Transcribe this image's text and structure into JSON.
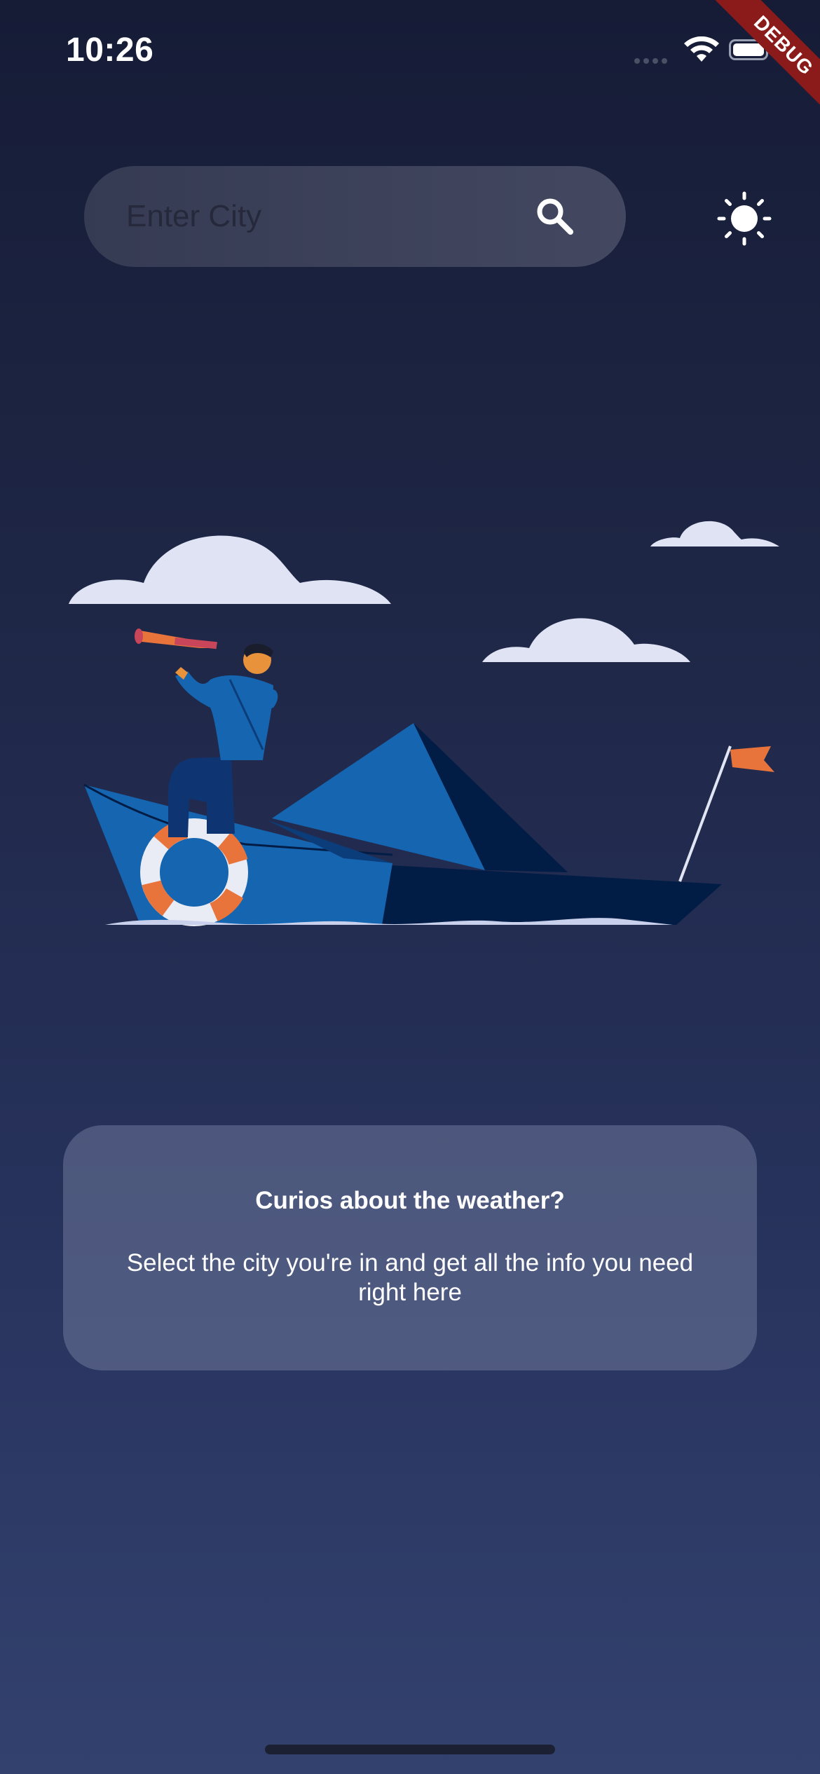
{
  "status_bar": {
    "time": "10:26",
    "signal_icon": "cellular-signal-icon",
    "wifi_icon": "wifi-icon",
    "battery_icon": "battery-icon"
  },
  "debug_banner": {
    "label": "DEBUG",
    "color": "#8b1a1a"
  },
  "search": {
    "placeholder": "Enter City",
    "value": "",
    "icon": "search-icon"
  },
  "theme_toggle": {
    "icon": "sun-icon"
  },
  "illustration": {
    "icon": "boat-telescope-illustration"
  },
  "info_card": {
    "title": "Curios about the weather?",
    "body": "Select the city you're in and get all the info you need right here"
  },
  "colors": {
    "background_top": "#161c36",
    "background_bottom": "#33416f",
    "boat_blue": "#1565b0",
    "boat_dark": "#021d45",
    "accent_orange": "#e8743b",
    "cloud": "#dfe3f3"
  }
}
